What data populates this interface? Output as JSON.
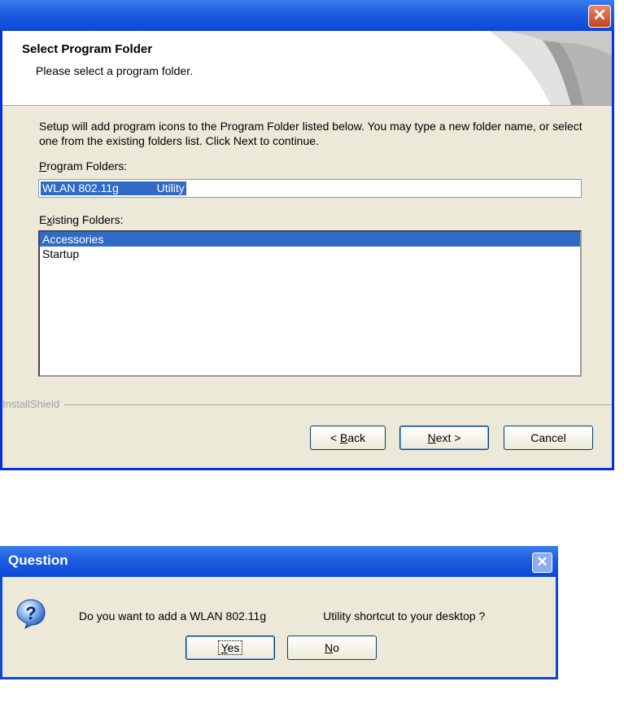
{
  "wizard": {
    "close_glyph": "✕",
    "header": {
      "title": "Select Program Folder",
      "subtitle": "Please select a program folder."
    },
    "description": "Setup will add program icons to the Program Folder listed below.  You may type a new folder name, or select one from the existing folders list.  Click Next to continue.",
    "program_folders_label": {
      "mnemonic": "P",
      "rest": "rogram Folders:"
    },
    "program_folder_value": "WLAN 802.11g            Utility",
    "existing_folders_label": {
      "pre": "E",
      "mnemonic": "x",
      "rest": "isting Folders:"
    },
    "existing_folders": [
      "Accessories",
      "Startup"
    ],
    "selected_folder": "Accessories",
    "installshield_label": "InstallShield",
    "buttons": {
      "back": {
        "prefix": "< ",
        "mnemonic": "B",
        "rest": "ack"
      },
      "next": {
        "mnemonic": "N",
        "rest": "ext >"
      },
      "cancel": "Cancel"
    }
  },
  "question": {
    "title": "Question",
    "close_glyph": "✕",
    "icon": "question-icon",
    "message": "Do you want to add a WLAN 802.11g                  Utility shortcut to your desktop ?",
    "buttons": {
      "yes": {
        "mnemonic": "Y",
        "rest": "es"
      },
      "no": {
        "mnemonic": "N",
        "rest": "o"
      }
    }
  },
  "colors": {
    "title_blue": "#0a48d8",
    "dialog_face": "#ece9d8",
    "selection": "#316ac5",
    "close_red": "#c5421e"
  }
}
